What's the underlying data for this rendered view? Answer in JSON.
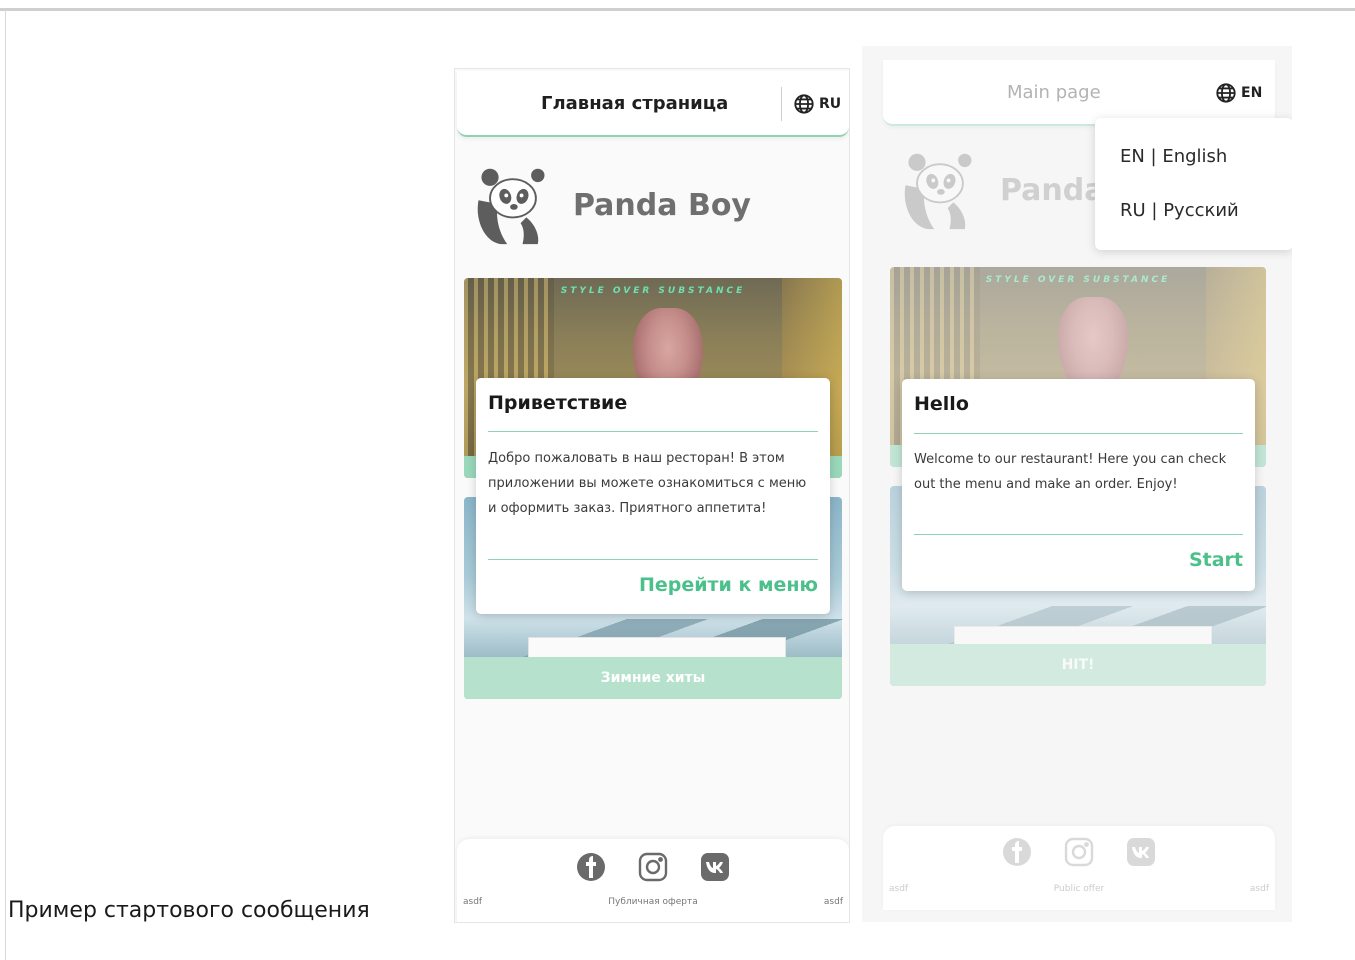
{
  "caption": "Пример стартового сообщения",
  "colors": {
    "accent": "#4cc08a",
    "accent_soft": "#b6e1cd",
    "rule": "#8fd3b3"
  },
  "ru": {
    "header_title": "Главная страница",
    "lang_label": "RU",
    "brand_name": "Panda Boy",
    "poster_tag": "STYLE OVER SUBSTANCE",
    "hits_label": "Зимние хиты",
    "dialog": {
      "title": "Приветствие",
      "text": "Добро пожаловать в наш ресторан! В этом приложении вы можете ознакомиться с меню и оформить заказ. Приятного аппетита!",
      "action": "Перейти к меню"
    },
    "footer": {
      "left": "asdf",
      "middle": "Публичная оферта",
      "right": "asdf"
    },
    "socials": [
      "facebook-icon",
      "instagram-icon",
      "vk-icon"
    ]
  },
  "en": {
    "header_title": "Main page",
    "lang_label": "EN",
    "brand_name": "Panda",
    "poster_tag": "STYLE OVER SUBSTANCE",
    "hits_label": "HIT!",
    "lang_menu": [
      "EN | English",
      "RU | Русский"
    ],
    "dialog": {
      "title": "Hello",
      "text": "Welcome to our restaurant! Here you can check out the menu and make an order. Enjoy!",
      "action": "Start"
    },
    "footer": {
      "left": "asdf",
      "middle": "Public offer",
      "right": "asdf"
    },
    "socials": [
      "facebook-icon",
      "instagram-icon",
      "vk-icon"
    ]
  }
}
